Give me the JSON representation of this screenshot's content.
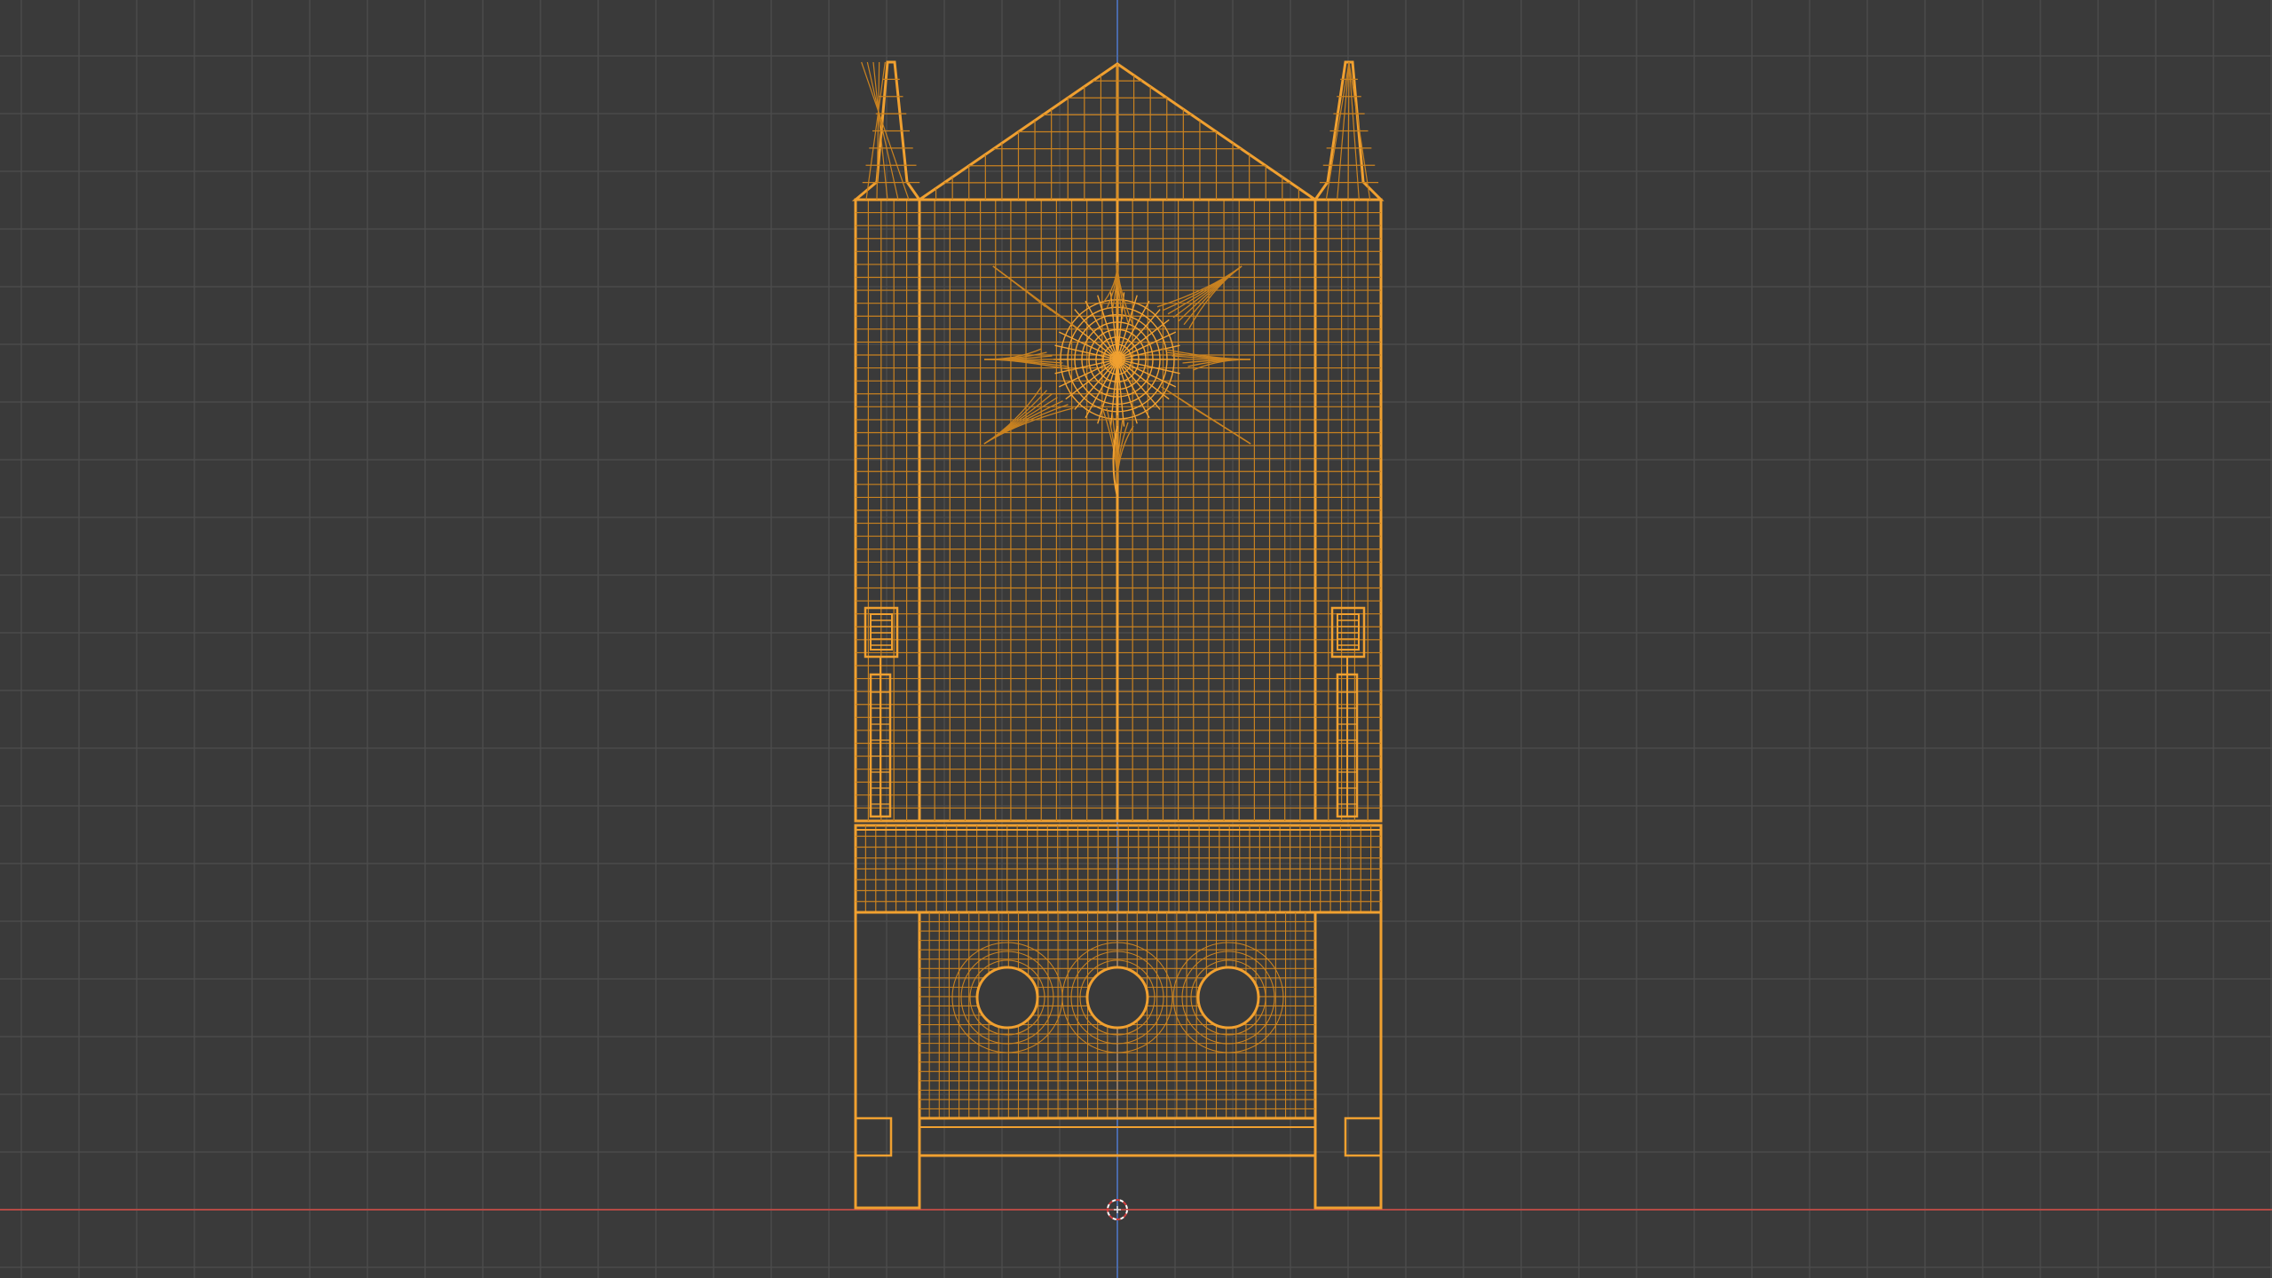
{
  "app": {
    "name": "",
    "view": "front-orthographic"
  },
  "viewport": {
    "background_color": "#3a3a3a",
    "grid_color": "#4b4b4b",
    "axis_x_color": "#b34a45",
    "axis_z_color": "#4a6aa8",
    "wire_color": "#f0a030",
    "wire_dim_color": "#c98220",
    "cursor_icon": "3d-cursor-icon",
    "object": {
      "name": "",
      "mode": "wireframe",
      "selected": true
    }
  }
}
